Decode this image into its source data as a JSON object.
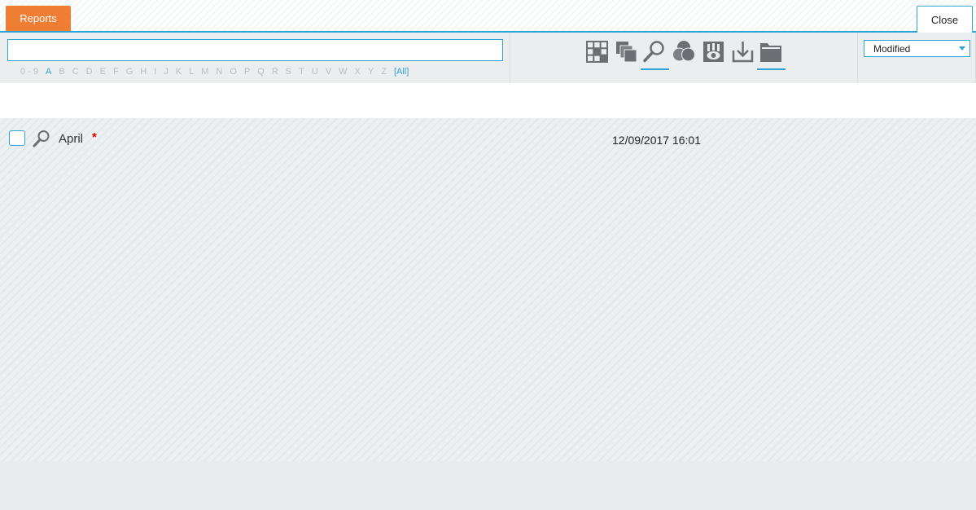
{
  "header": {
    "tab_label": "Reports",
    "close_label": "Close"
  },
  "search": {
    "value": "",
    "placeholder": ""
  },
  "alphabet": [
    "0 - 9",
    "A",
    "B",
    "C",
    "D",
    "E",
    "F",
    "G",
    "H",
    "I",
    "J",
    "K",
    "L",
    "M",
    "N",
    "O",
    "P",
    "Q",
    "R",
    "S",
    "T",
    "U",
    "V",
    "W",
    "X",
    "Y",
    "Z",
    "[All]"
  ],
  "alphabet_active": "A",
  "toolbar_icons": [
    "grid-icon",
    "copy-icon",
    "search-icon",
    "color-filter-icon",
    "hierarchy-view-icon",
    "download-icon",
    "folder-icon"
  ],
  "toolbar_icons_underlined": [
    "search-icon",
    "folder-icon"
  ],
  "sort": {
    "selected": "Modified"
  },
  "rows": [
    {
      "name": "April",
      "flag": "*",
      "modified": "12/09/2017 16:01"
    }
  ],
  "colors": {
    "accent": "#2ea3d6",
    "tab": "#ef7d33",
    "icon": "#6b6e72",
    "flag": "#e00000"
  }
}
